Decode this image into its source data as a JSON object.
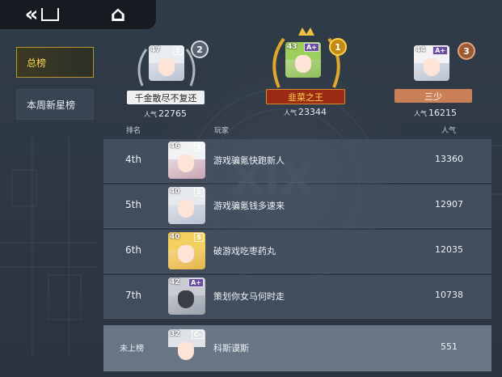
{
  "nav": {
    "back_icon": "«",
    "home_icon": "⌂"
  },
  "tabs": [
    {
      "label": "总榜",
      "active": true
    },
    {
      "label": "本周新星榜",
      "active": false
    }
  ],
  "top3": [
    {
      "rank": "2",
      "level": "47",
      "rarity": "S",
      "name": "千金散尽不复还",
      "pop_label": "人气",
      "popularity": "22765",
      "plate_color": "#e9ecef"
    },
    {
      "rank": "1",
      "level": "43",
      "rarity": "A+",
      "name": "韭菜之王",
      "pop_label": "人气",
      "popularity": "23344",
      "plate_color": "#9a2a13"
    },
    {
      "rank": "3",
      "level": "44",
      "rarity": "A+",
      "name": "三少",
      "pop_label": "人气",
      "popularity": "16215",
      "plate_color": "#c98056"
    }
  ],
  "table": {
    "columns": {
      "rank": "排名",
      "player": "玩家",
      "popularity": "人气"
    },
    "rows": [
      {
        "rank": "4th",
        "level": "46",
        "rarity": "S",
        "name": "游戏骗氪快跑新人",
        "score": "13360"
      },
      {
        "rank": "5th",
        "level": "40",
        "rarity": "S",
        "name": "游戏骗氪钱多速来",
        "score": "12907"
      },
      {
        "rank": "6th",
        "level": "40",
        "rarity": "S",
        "name": "破游戏吃枣药丸",
        "score": "12035"
      },
      {
        "rank": "7th",
        "level": "42",
        "rarity": "A+",
        "name": "策划你女马何时走",
        "score": "10738"
      }
    ],
    "self": {
      "rank": "未上榜",
      "level": "32",
      "rarity": "C-",
      "name": "科斯谟斯",
      "score": "551"
    }
  }
}
